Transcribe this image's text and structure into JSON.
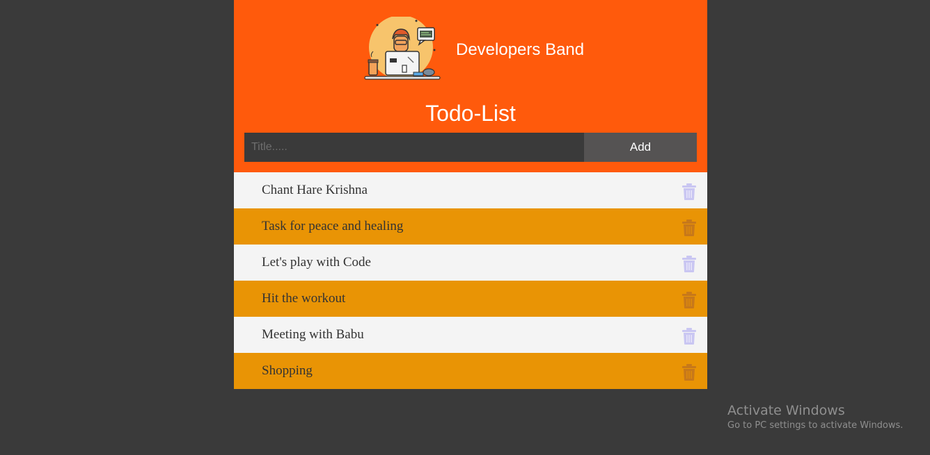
{
  "header": {
    "brand_name": "Developers Band",
    "title": "Todo-List"
  },
  "form": {
    "placeholder": "Title.....",
    "value": "",
    "add_label": "Add"
  },
  "todos": [
    {
      "text": "Chant Hare Krishna",
      "style": "light"
    },
    {
      "text": "Task for peace and healing",
      "style": "amber"
    },
    {
      "text": "Let's play with Code",
      "style": "light"
    },
    {
      "text": "Hit the workout",
      "style": "amber"
    },
    {
      "text": "Meeting with Babu",
      "style": "light"
    },
    {
      "text": "Shopping",
      "style": "amber"
    }
  ],
  "colors": {
    "header_bg": "#ff5a0c",
    "page_bg": "#3a3a3a",
    "row_light": "#f4f4f4",
    "row_amber": "#e99405",
    "add_button_bg": "#555353"
  },
  "icons": {
    "logo": "developer-at-desk-logo",
    "delete": "trash-icon"
  },
  "watermark": {
    "title": "Activate Windows",
    "subtitle": "Go to PC settings to activate Windows."
  }
}
